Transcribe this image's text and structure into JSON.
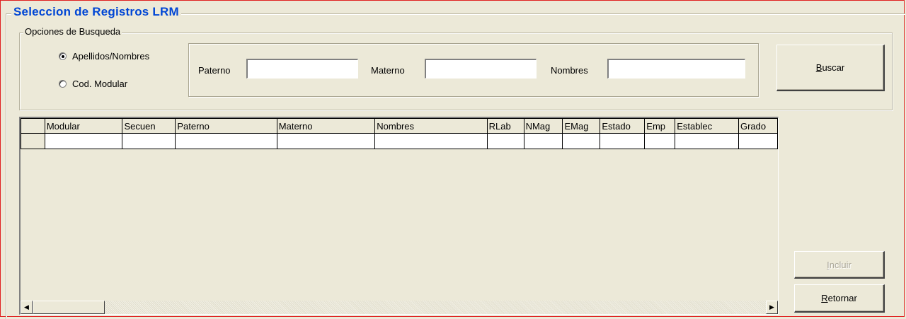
{
  "form": {
    "title": "Seleccion de Registros LRM"
  },
  "search_options": {
    "label": "Opciones de Busqueda",
    "radio_names": {
      "label": "Apellidos/Nombres",
      "selected": true
    },
    "radio_code": {
      "label": "Cod. Modular",
      "selected": false
    }
  },
  "fields": {
    "paterno": {
      "label": "Paterno",
      "value": ""
    },
    "materno": {
      "label": "Materno",
      "value": ""
    },
    "nombres": {
      "label": "Nombres",
      "value": ""
    }
  },
  "buttons": {
    "buscar": {
      "accel": "B",
      "rest": "uscar"
    },
    "incluir": {
      "accel": "I",
      "rest": "ncluir",
      "enabled": false
    },
    "retornar": {
      "accel": "R",
      "rest": "etornar"
    }
  },
  "grid": {
    "columns": [
      "Modular",
      "Secuen",
      "Paterno",
      "Materno",
      "Nombres",
      "RLab",
      "NMag",
      "EMag",
      "Estado",
      "Emp",
      "Establec",
      "Grado"
    ],
    "rows": [
      [
        "",
        "",
        "",
        "",
        "",
        "",
        "",
        "",
        "",
        "",
        "",
        ""
      ]
    ]
  },
  "icons": {
    "scroll_left": "triangle-left-icon",
    "scroll_right": "triangle-right-icon"
  }
}
